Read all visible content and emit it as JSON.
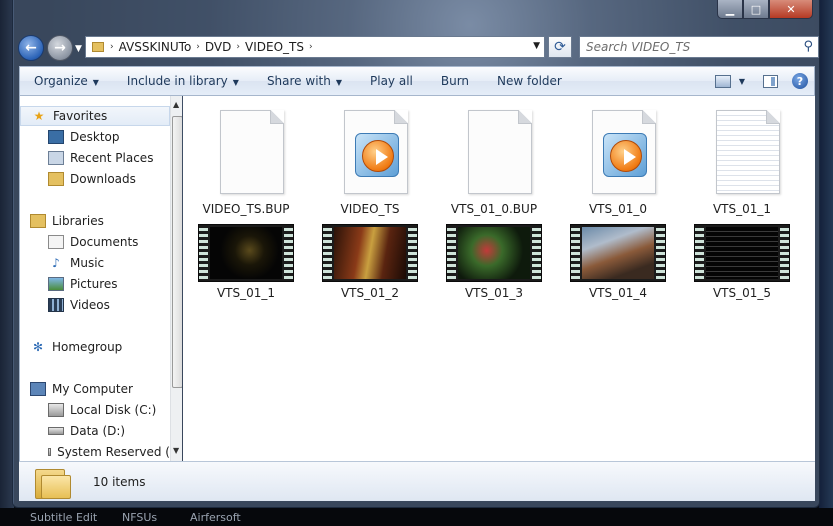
{
  "window": {
    "title": ""
  },
  "address": {
    "crumbs": [
      "AVSSKINUTo",
      "DVD",
      "VIDEO_TS"
    ]
  },
  "search": {
    "placeholder": "Search VIDEO_TS"
  },
  "toolbar": {
    "organize": "Organize",
    "include": "Include in library",
    "share": "Share with",
    "play": "Play all",
    "burn": "Burn",
    "newfolder": "New folder"
  },
  "nav": {
    "favorites": "Favorites",
    "desktop": "Desktop",
    "recent": "Recent Places",
    "downloads": "Downloads",
    "libraries": "Libraries",
    "documents": "Documents",
    "music": "Music",
    "pictures": "Pictures",
    "videos": "Videos",
    "homegroup": "Homegroup",
    "computer": "My Computer",
    "localdisk": "Local Disk (C:)",
    "data": "Data (D:)",
    "system": "System Reserved ("
  },
  "files": [
    {
      "name": "VIDEO_TS.BUP",
      "icon": "blank-document-icon"
    },
    {
      "name": "VIDEO_TS",
      "icon": "media-player-icon"
    },
    {
      "name": "VTS_01_0.BUP",
      "icon": "blank-document-icon"
    },
    {
      "name": "VTS_01_0",
      "icon": "media-player-icon"
    },
    {
      "name": "VTS_01_1",
      "icon": "text-document-icon"
    },
    {
      "name": "VTS_01_1",
      "icon": "video-thumbnail-icon"
    },
    {
      "name": "VTS_01_2",
      "icon": "video-thumbnail-icon"
    },
    {
      "name": "VTS_01_3",
      "icon": "video-thumbnail-icon"
    },
    {
      "name": "VTS_01_4",
      "icon": "video-thumbnail-icon"
    },
    {
      "name": "VTS_01_5",
      "icon": "video-thumbnail-icon"
    }
  ],
  "status": {
    "count": "10 items"
  },
  "taskbar": [
    "Subtitle Edit",
    "NFSUs",
    "Airfersoft"
  ],
  "colors": {
    "accent": "#1e395b",
    "folder": "#e4c060",
    "wmp_orange": "#f07a12"
  }
}
